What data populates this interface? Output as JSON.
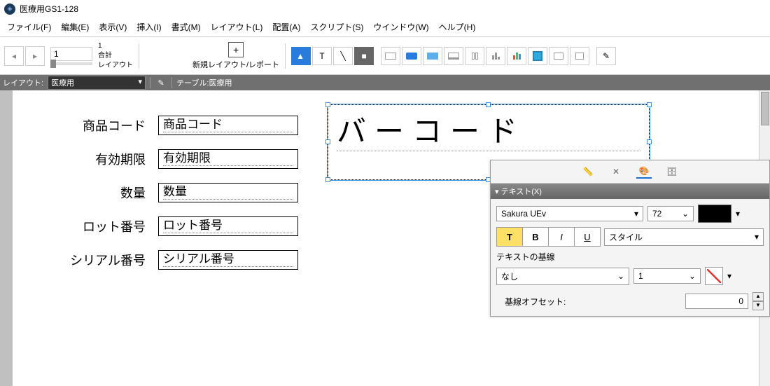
{
  "window": {
    "title": "医療用GS1-128"
  },
  "menu": {
    "file": "ファイル(F)",
    "filekey": "F",
    "edit": "編集(E)",
    "editkey": "E",
    "view": "表示(V)",
    "viewkey": "V",
    "insert": "挿入(I)",
    "insertkey": "I",
    "format": "書式(M)",
    "formatkey": "M",
    "layout": "レイアウト(L)",
    "layoutkey": "L",
    "arrange": "配置(A)",
    "arrangekey": "A",
    "script": "スクリプト(S)",
    "scriptkey": "S",
    "window": "ウインドウ(W)",
    "windowkey": "W",
    "help": "ヘルプ(H)",
    "helpkey": "H"
  },
  "toolbar": {
    "record": "1",
    "total": "1",
    "total_label_a": "合計",
    "total_label_b": "レイアウト",
    "newlayout": "新規レイアウト/レポート"
  },
  "layoutbar": {
    "label": "レイアウト:",
    "selected": "医療用",
    "tablelabel": "テーブル:",
    "table": "医療用"
  },
  "form": {
    "labels": [
      "商品コード",
      "有効期限",
      "数量",
      "ロット番号",
      "シリアル番号"
    ],
    "fields": [
      "商品コード",
      "有効期限",
      "数量",
      "ロット番号",
      "シリアル番号"
    ],
    "large_field": "バーコード"
  },
  "inspector": {
    "header": "テキスト(X)",
    "font": "Sakura UEv",
    "size": "72",
    "style_placeholder": "スタイル",
    "baseline_label": "テキストの基線",
    "baseline": "なし",
    "baseline_num": "1",
    "offset_label": "基線オフセット:",
    "offset": "0"
  }
}
